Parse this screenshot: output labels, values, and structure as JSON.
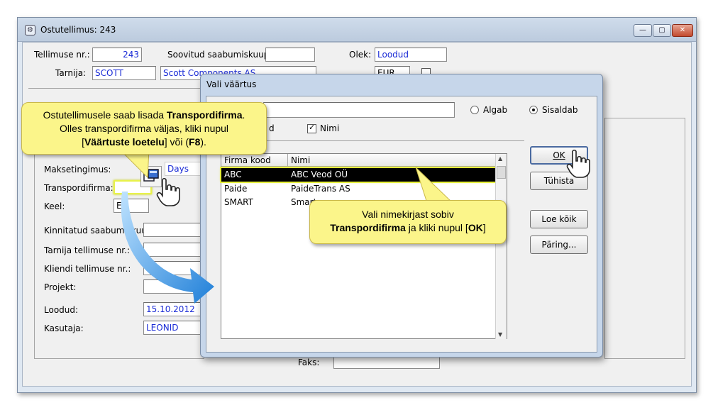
{
  "main_window": {
    "title": "Ostutellimus: 243",
    "fields": {
      "tellimuse_nr_label": "Tellimuse nr.:",
      "tellimuse_nr_value": "243",
      "soovitud_label": "Soovitud saabumiskuup.:",
      "olek_label": "Olek:",
      "olek_value": "Loodud",
      "tarnija_label": "Tarnija:",
      "tarnija_code": "SCOTT",
      "tarnija_name": "Scott Components AS",
      "valuuta_value": "EUR",
      "maksetingimus_label": "Maksetingimus:",
      "maksetingimus_value": "Days",
      "transpordifirma_label": "Transpordifirma:",
      "keel_label": "Keel:",
      "keel_value": "ET",
      "kinnitatud_label": "Kinnitatud saabumiskuup.:",
      "tarnija_tell_label": "Tarnija tellimuse nr.:",
      "kliendi_tell_label": "Kliendi tellimuse nr.:",
      "projekt_label": "Projekt:",
      "loodud_label": "Loodud:",
      "loodud_value": "15.10.2012",
      "kasutaja_label": "Kasutaja:",
      "kasutaja_value": "LEONID",
      "faks_label": "Faks:"
    }
  },
  "dialog": {
    "title": "Vali väärtus",
    "radio_algab": "Algab",
    "radio_sisaldab": "Sisaldab",
    "checkbox_kood_partial": "d",
    "checkbox_nimi": "Nimi",
    "columns": [
      "Firma kood",
      "Nimi"
    ],
    "rows": [
      {
        "code": "ABC",
        "name": "ABC Veod OÜ"
      },
      {
        "code": "Paide",
        "name": "PaideTrans AS"
      },
      {
        "code": "SMART",
        "name": "Smart"
      }
    ],
    "buttons": {
      "ok": "OK",
      "tuhista": "Tühista",
      "loe_koik": "Loe kõik",
      "paring": "Päring..."
    }
  },
  "callout_left": {
    "line1_pre": "Ostutellimusele saab lisada ",
    "line1_bold": "Transpordifirma",
    "line1_post": ".",
    "line2": "Olles transpordifirma väljas, kliki nupul",
    "line3_pre": "[",
    "line3_bold1": "Väärtuste loetelu",
    "line3_mid": "] või (",
    "line3_bold2": "F8",
    "line3_post": ")."
  },
  "callout_right": {
    "line1": "Vali nimekirjast sobiv",
    "line2_bold": "Transpordifirma",
    "line2_mid": " ja kliki nupul [",
    "line2_bold2": "OK",
    "line2_post": "]"
  },
  "colors": {
    "callout_fill": "#fbf58a",
    "highlight": "#e6f03c",
    "arrow": "#2f8fe0",
    "selection": "#000000"
  }
}
